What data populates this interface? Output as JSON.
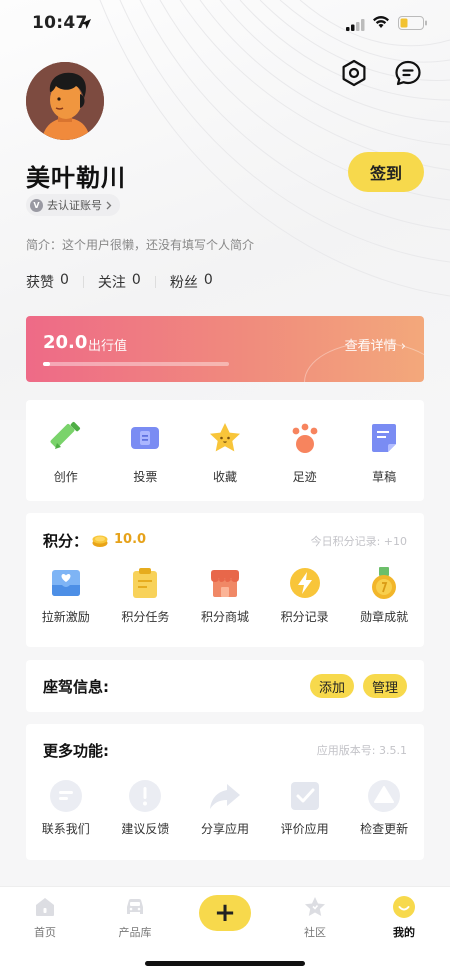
{
  "status_bar": {
    "time": "10:47"
  },
  "profile": {
    "name": "美叶勒川",
    "checkin_label": "签到",
    "verify_label": "去认证账号",
    "verify_badge": "V",
    "bio": "简介：这个用户很懒，还没有填写个人简介",
    "stats": [
      {
        "label": "获赞",
        "value": "0"
      },
      {
        "label": "关注",
        "value": "0"
      },
      {
        "label": "粉丝",
        "value": "0"
      }
    ]
  },
  "score_banner": {
    "value": "20.0",
    "unit": "出行值",
    "detail_link": "查看详情 ›",
    "progress": 0.04
  },
  "quick_actions": [
    {
      "label": "创作",
      "icon": "pencil-icon"
    },
    {
      "label": "投票",
      "icon": "ballot-icon"
    },
    {
      "label": "收藏",
      "icon": "star-icon"
    },
    {
      "label": "足迹",
      "icon": "paw-icon"
    },
    {
      "label": "草稿",
      "icon": "draft-icon"
    }
  ],
  "points": {
    "title": "积分：",
    "value": "10.0",
    "today_record": "今日积分记录: +10",
    "items": [
      {
        "label": "拉新激励",
        "icon": "invite-icon"
      },
      {
        "label": "积分任务",
        "icon": "task-clipboard-icon"
      },
      {
        "label": "积分商城",
        "icon": "shop-icon"
      },
      {
        "label": "积分记录",
        "icon": "lightning-icon"
      },
      {
        "label": "勋章成就",
        "icon": "medal-icon"
      }
    ]
  },
  "seat": {
    "title": "座驾信息:",
    "add_label": "添加",
    "manage_label": "管理"
  },
  "more": {
    "title": "更多功能:",
    "version": "应用版本号: 3.5.1",
    "items": [
      {
        "label": "联系我们",
        "icon": "contact-icon"
      },
      {
        "label": "建议反馈",
        "icon": "feedback-icon"
      },
      {
        "label": "分享应用",
        "icon": "share-icon"
      },
      {
        "label": "评价应用",
        "icon": "rate-check-icon"
      },
      {
        "label": "检查更新",
        "icon": "update-icon"
      }
    ]
  },
  "tabbar": {
    "home": "首页",
    "products": "产品库",
    "plus": "+",
    "community": "社区",
    "mine": "我的"
  },
  "colors": {
    "accent_yellow": "#f7d94c",
    "banner_start": "#ee6a87",
    "banner_end": "#f3a87b",
    "points_gold": "#e6a21a"
  }
}
